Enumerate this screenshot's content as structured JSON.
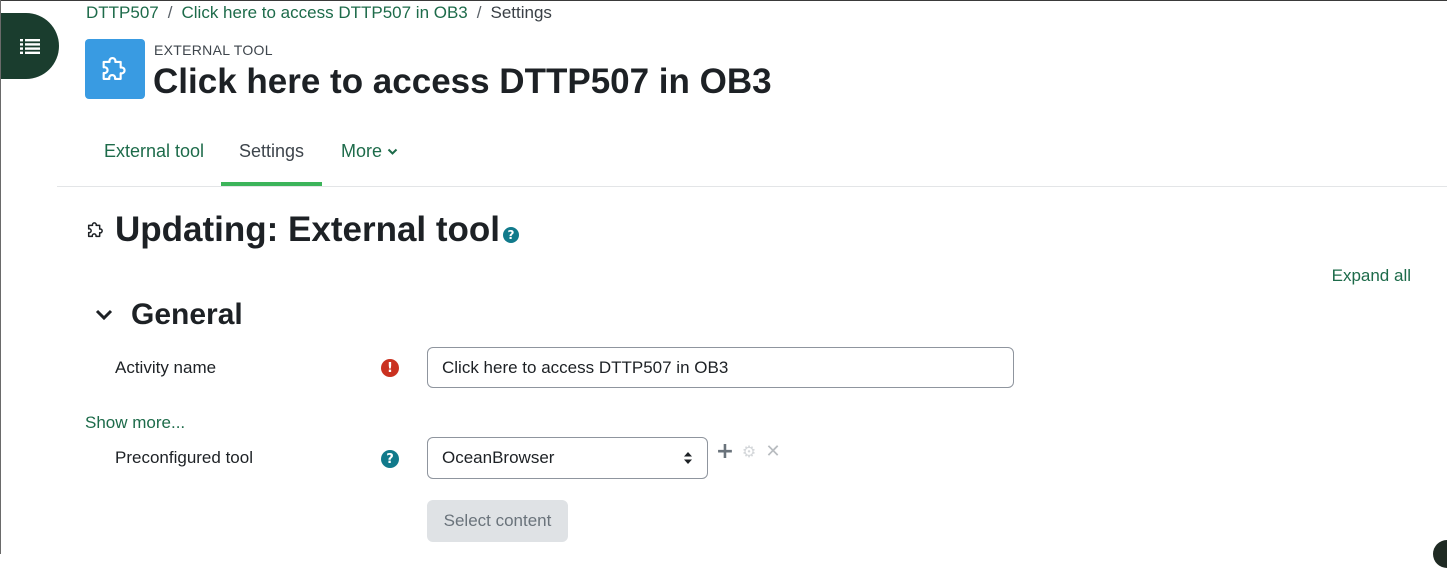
{
  "breadcrumb": {
    "course": "DTTP507",
    "activity": "Click here to access DTTP507 in OB3",
    "current": "Settings",
    "separator": "/"
  },
  "header": {
    "kicker": "EXTERNAL TOOL",
    "title": "Click here to access DTTP507 in OB3",
    "icon": "puzzle-icon",
    "icon_color": "#399be2"
  },
  "nav": {
    "tabs": [
      {
        "label": "External tool",
        "active": false
      },
      {
        "label": "Settings",
        "active": true
      },
      {
        "label": "More",
        "active": false
      }
    ],
    "accent": "#3cb45a"
  },
  "form": {
    "heading": "Updating: External tool",
    "help_symbol": "?",
    "expand_all": "Expand all",
    "section_general": "General",
    "activity_name": {
      "label": "Activity name",
      "value": "Click here to access DTTP507 in OB3",
      "required_symbol": "!"
    },
    "show_more": "Show more...",
    "preconfigured_tool": {
      "label": "Preconfigured tool",
      "selected": "OceanBrowser",
      "actions": {
        "add": "+",
        "configure": "⚙",
        "remove": "✕"
      }
    },
    "select_content": "Select content"
  },
  "colors": {
    "link": "#1d6b4a",
    "drawer": "#1a3d2e",
    "required": "#ca3120",
    "help": "#117a8b"
  }
}
